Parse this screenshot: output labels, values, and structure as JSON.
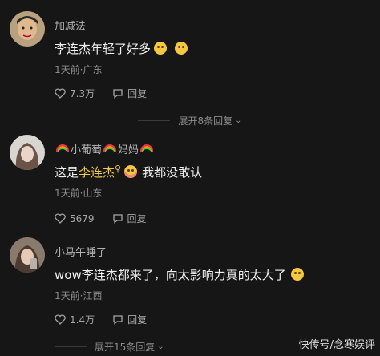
{
  "comments": [
    {
      "user": "加减法",
      "text": "李连杰年轻了好多",
      "meta": "1天前·广东",
      "likes": "7.3万",
      "reply_label": "回复",
      "expand": "展开8条回复"
    },
    {
      "user_parts": [
        "小葡萄",
        "妈妈"
      ],
      "text_prefix": "这是",
      "text_highlight": "李连杰",
      "text_suffix": "我都没敢认",
      "meta": "1天前·山东",
      "likes": "5679",
      "reply_label": "回复"
    },
    {
      "user": "小马午睡了",
      "text": "wow李连杰都来了，向太影响力真的太大了",
      "meta": "1天前·江西",
      "likes": "1.4万",
      "reply_label": "回复",
      "expand": "展开15条回复"
    }
  ],
  "watermark": "快传号/念寒娱评",
  "colors": {
    "background": "#161616",
    "highlight": "#f2c94c"
  }
}
